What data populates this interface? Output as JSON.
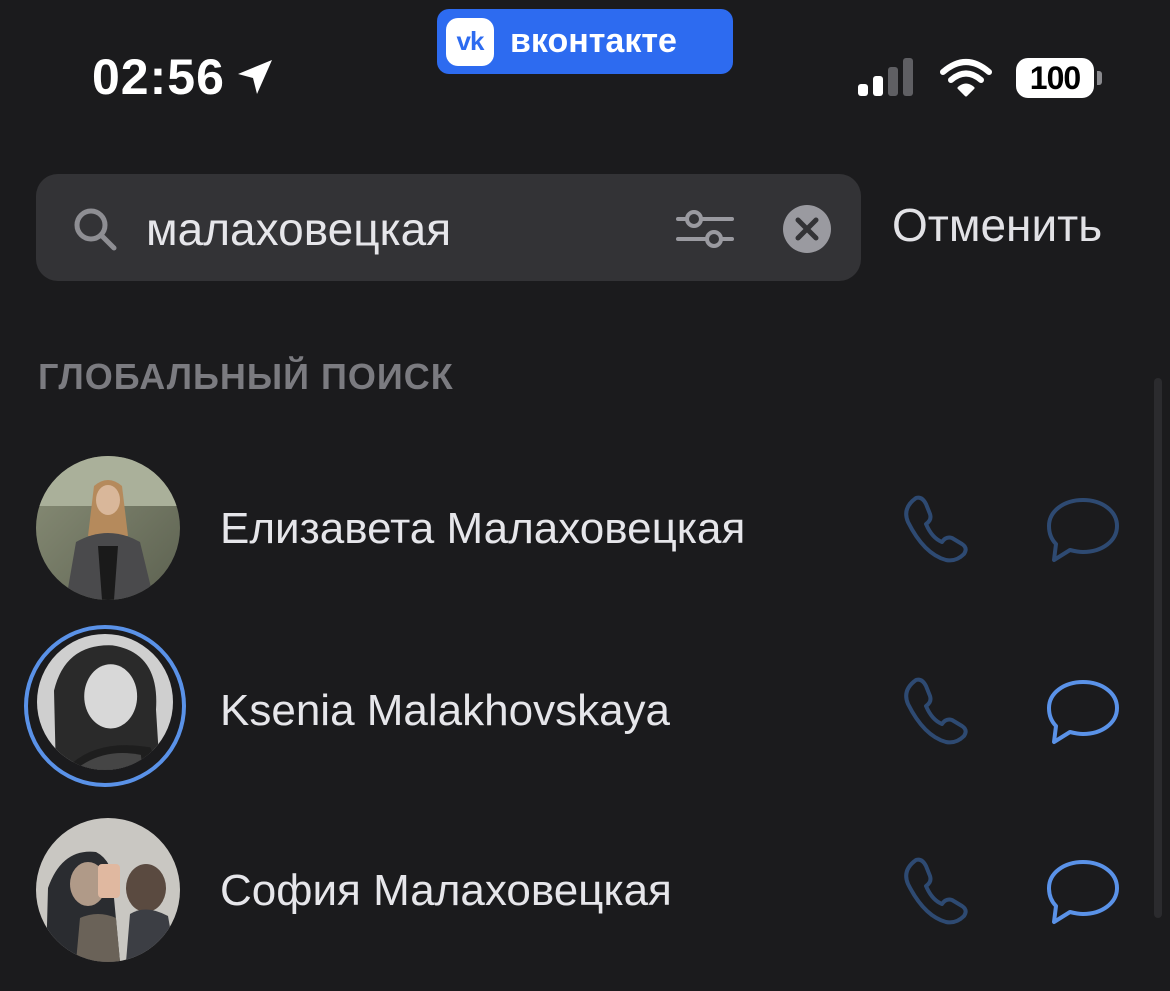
{
  "status_bar": {
    "time": "02:56",
    "app_name": "вконтакте",
    "app_logo_text": "vk",
    "battery": "100",
    "icons": [
      "location-arrow-icon",
      "signal-icon",
      "wifi-icon",
      "battery-icon"
    ]
  },
  "search": {
    "value": "малаховецкая",
    "placeholder": "",
    "cancel_label": "Отменить"
  },
  "section": {
    "title": "ГЛОБАЛЬНЫЙ ПОИСК"
  },
  "results": [
    {
      "name": "Елизавета Малаховецкая",
      "has_story": false,
      "message_active": false
    },
    {
      "name": "Ksenia Malakhovskaya",
      "has_story": true,
      "message_active": true
    },
    {
      "name": "София Малаховецкая",
      "has_story": false,
      "message_active": true
    }
  ],
  "colors": {
    "background": "#1b1b1d",
    "vk_blue": "#2d6bf0",
    "story_ring": "#5a92e8",
    "icon_active": "#5a92e8",
    "icon_muted": "#2e4a72",
    "section_text": "#7b7b80"
  }
}
